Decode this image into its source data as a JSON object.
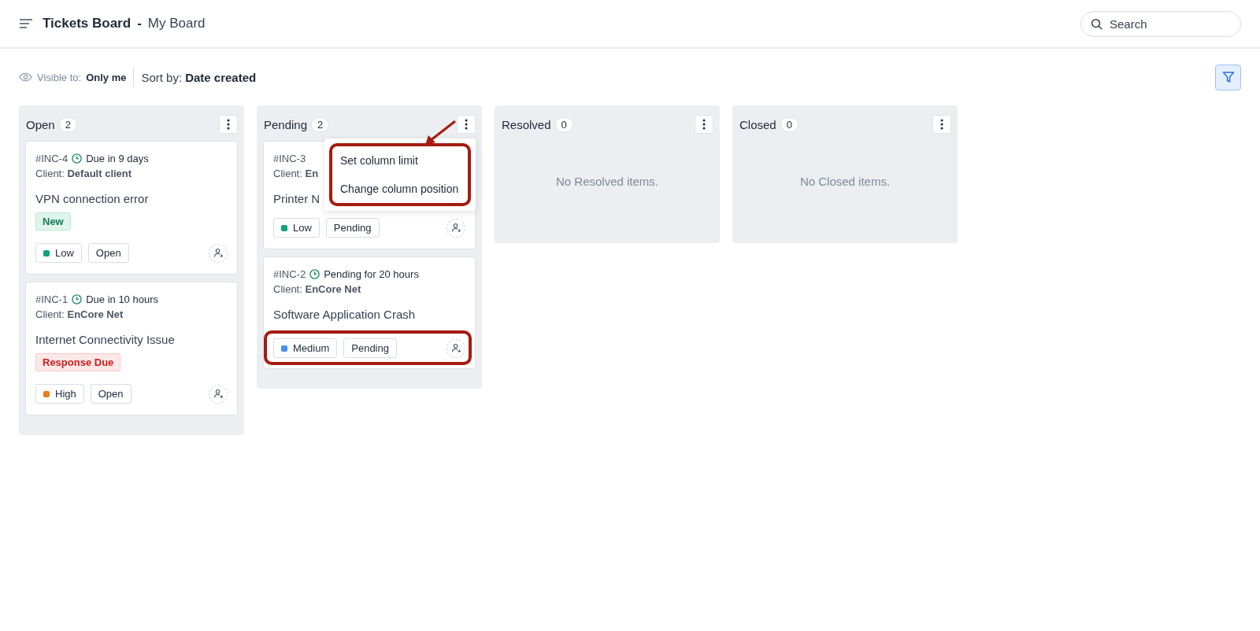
{
  "header": {
    "title": "Tickets Board",
    "separator": "-",
    "board": "My Board",
    "search": {
      "placeholder": "Search"
    }
  },
  "toolbar": {
    "visible_label": "Visible to:",
    "visible_value": "Only me",
    "sort_label": "Sort by:",
    "sort_value": "Date created",
    "filter_active": true
  },
  "columns": [
    {
      "name": "Open",
      "count": "2",
      "cards": [
        {
          "id": "#INC-4",
          "due": "Due in 9 days",
          "client_label": "Client:",
          "client": "Default client",
          "title": "VPN connection error",
          "tag": {
            "kind": "new",
            "text": "New"
          },
          "priority": {
            "text": "Low",
            "color": "#12a37f"
          },
          "status": "Open",
          "highlighted": false
        },
        {
          "id": "#INC-1",
          "due": "Due in 10 hours",
          "client_label": "Client:",
          "client": "EnCore Net",
          "title": "Internet Connectivity Issue",
          "tag": {
            "kind": "alert",
            "text": "Response Due"
          },
          "priority": {
            "text": "High",
            "color": "#ef7a1a"
          },
          "status": "Open",
          "highlighted": false
        }
      ]
    },
    {
      "name": "Pending",
      "count": "2",
      "menu": {
        "items": [
          "Set column limit",
          "Change column position"
        ],
        "highlighted": true
      },
      "cards": [
        {
          "id": "#INC-3",
          "client_label": "Client:",
          "client": "En",
          "title": "Printer N",
          "priority": {
            "text": "Low",
            "color": "#12a37f"
          },
          "status": "Pending",
          "highlighted": false
        },
        {
          "id": "#INC-2",
          "due": "Pending for 20 hours",
          "client_label": "Client:",
          "client": "EnCore Net",
          "title": "Software Application Crash",
          "priority": {
            "text": "Medium",
            "color": "#4a90f0"
          },
          "status": "Pending",
          "highlighted": true
        }
      ]
    },
    {
      "name": "Resolved",
      "count": "0",
      "empty": "No Resolved items."
    },
    {
      "name": "Closed",
      "count": "0",
      "empty": "No Closed items."
    }
  ]
}
